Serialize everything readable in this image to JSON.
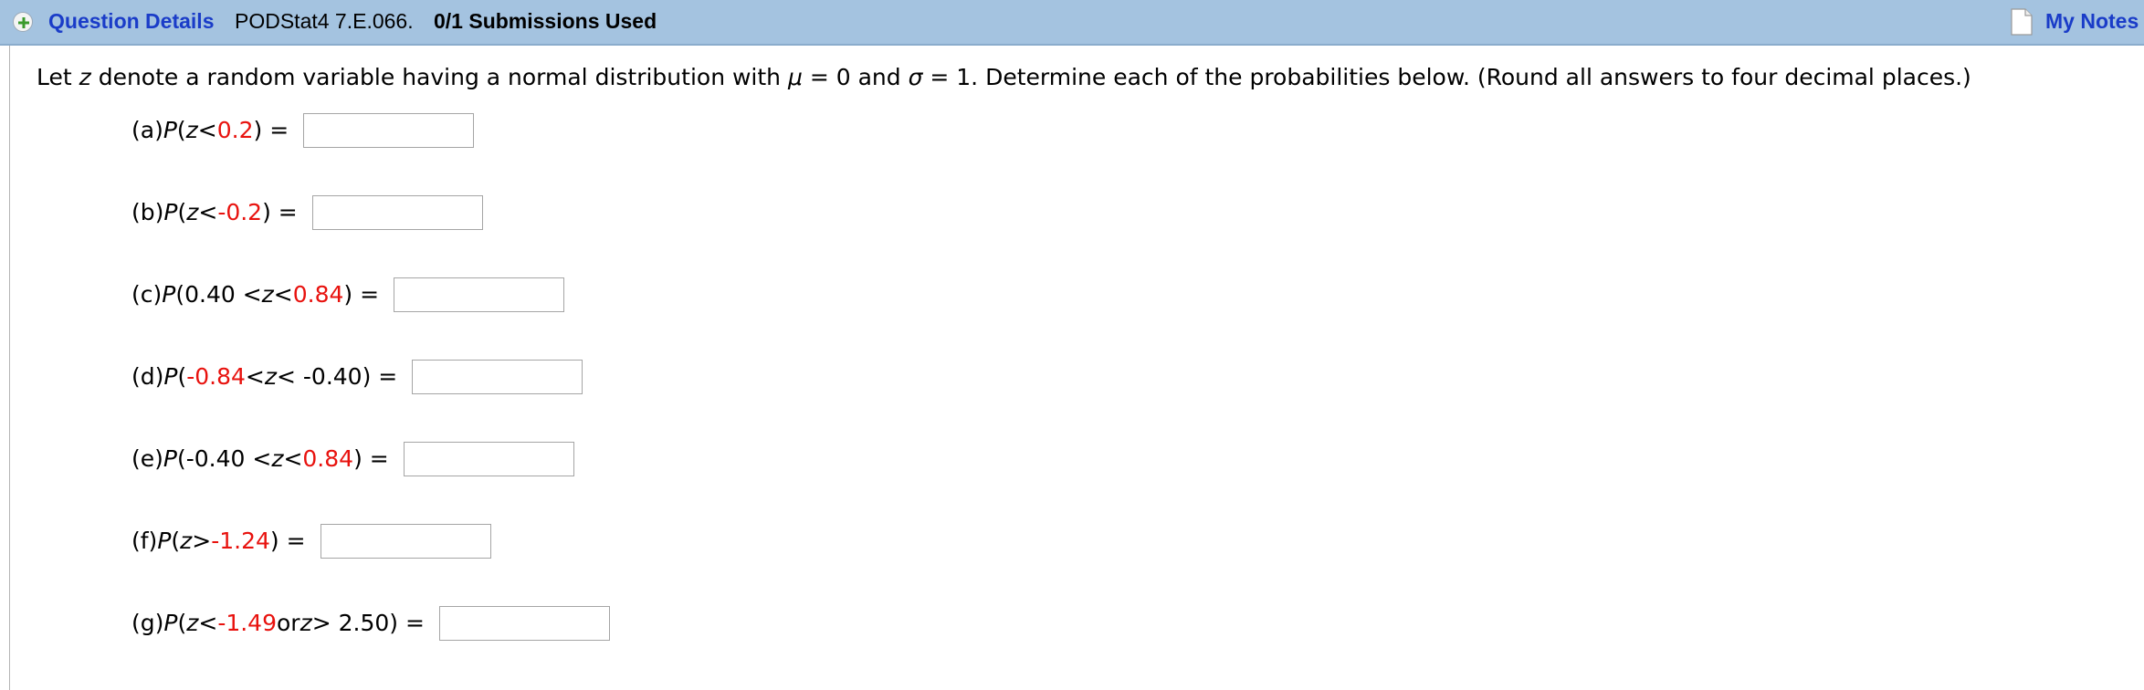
{
  "header": {
    "question_details_label": "Question Details",
    "question_id": "PODStat4 7.E.066.",
    "submissions": "0/1 Submissions Used",
    "my_notes_label": "My Notes",
    "background_color": "#a4c3e0",
    "link_color": "#1a3cc8"
  },
  "prompt": {
    "part1": "Let ",
    "var_z": "z",
    "part2": " denote a random variable having a normal distribution with ",
    "mu": "μ",
    "part3": " = 0 and ",
    "sigma": "σ",
    "part4": " = 1. Determine each of the probabilities below. (Round all answers to four decimal places.)"
  },
  "questions": [
    {
      "label": "(a) ",
      "P": "P",
      "t1": "(",
      "z1": "z",
      "t2": " < ",
      "r1": "0.2",
      "t3": ") = ",
      "answer": ""
    },
    {
      "label": "(b) ",
      "P": "P",
      "t1": "(",
      "z1": "z",
      "t2": " < ",
      "r1": "-0.2",
      "t3": ") = ",
      "answer": ""
    },
    {
      "label": "(c) ",
      "P": "P",
      "t1": "(0.40 < ",
      "z1": "z",
      "t2": " < ",
      "r1": "0.84",
      "t3": ") = ",
      "answer": ""
    },
    {
      "label": "(d) ",
      "P": "P",
      "t1": "(",
      "r1": "-0.84",
      "t2": " < ",
      "z1": "z",
      "t3": " < -0.40) = ",
      "answer": ""
    },
    {
      "label": "(e) ",
      "P": "P",
      "t1": "(-0.40 < ",
      "z1": "z",
      "t2": " < ",
      "r1": "0.84",
      "t3": ") = ",
      "answer": ""
    },
    {
      "label": "(f) ",
      "P": "P",
      "t1": "(",
      "z1": "z",
      "t2": " > ",
      "r1": "-1.24",
      "t3": ") = ",
      "answer": ""
    },
    {
      "label": "(g) ",
      "P": "P",
      "t1": "(",
      "z1": "z",
      "t2": " < ",
      "r1": "-1.49",
      "t3": " or ",
      "z2": "z",
      "t4": " > 2.50) = ",
      "answer": ""
    }
  ],
  "colors": {
    "highlight": "#e8120e"
  },
  "icons": {
    "expand": "plus-circle-icon",
    "notes": "document-icon"
  }
}
